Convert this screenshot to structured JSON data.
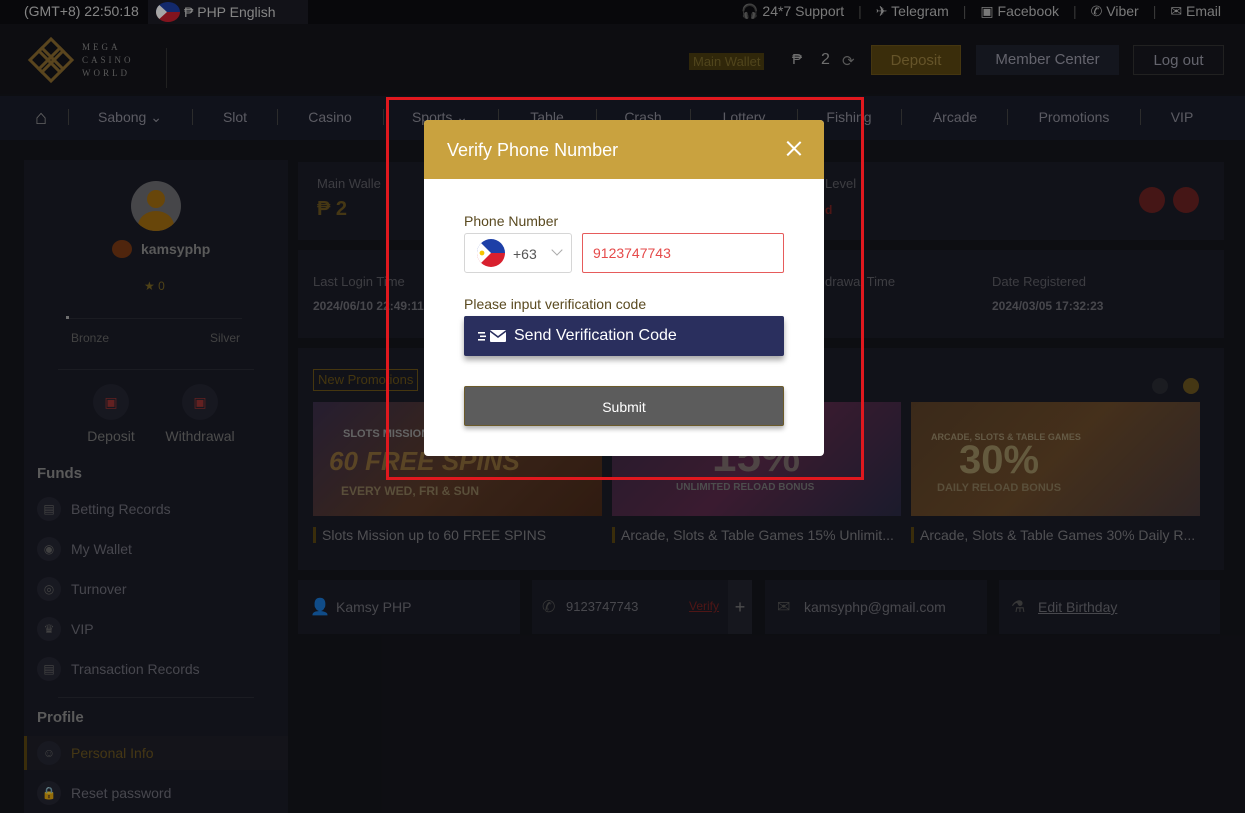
{
  "topbar": {
    "time": "(GMT+8) 22:50:18",
    "language": "₱ PHP English",
    "links": [
      "24*7 Support",
      "Telegram",
      "Facebook",
      "Viber",
      "Email"
    ]
  },
  "header": {
    "logo_lines": [
      "MEGA",
      "CASINO",
      "WORLD"
    ],
    "main_wallet_label": "Main Wallet",
    "currency_symbol": "₱",
    "balance": "2",
    "deposit_label": "Deposit",
    "member_center_label": "Member Center",
    "logout_label": "Log out"
  },
  "nav": {
    "items": [
      "Sabong",
      "Slot",
      "Casino",
      "Sports",
      "Table",
      "Crash",
      "Lottery",
      "Fishing",
      "Arcade",
      "Promotions",
      "VIP"
    ]
  },
  "sidebar": {
    "username": "kamsyphp",
    "stars": "★ 0",
    "level_from": "Bronze",
    "level_to": "Silver",
    "quick_buttons": [
      "Deposit",
      "Withdrawal"
    ],
    "funds_title": "Funds",
    "funds_items": [
      "Betting Records",
      "My Wallet",
      "Turnover",
      "VIP",
      "Transaction Records"
    ],
    "profile_title": "Profile",
    "profile_items": [
      "Personal Info",
      "Reset password"
    ]
  },
  "summary": {
    "main_wallet_label": "Main Walle",
    "main_wallet_value": "₱ 2",
    "level_label": "Level",
    "level_value": "d"
  },
  "login_info": {
    "last_login_label": "Last Login Time",
    "last_login_value": "2024/06/10 22:49:11",
    "withdraw_label": "drawal Time",
    "registered_label": "Date Registered",
    "registered_value": "2024/03/05 17:32:23"
  },
  "promotions": {
    "tag": "New Promotions",
    "cards": [
      {
        "banner_top": "SLOTS MISSION",
        "banner_big": "60 FREE SPINS",
        "banner_sub": "EVERY WED, FRI & SUN",
        "caption": "Slots Mission up to 60 FREE SPINS"
      },
      {
        "banner_big": "15%",
        "banner_sub": "UNLIMITED RELOAD BONUS",
        "caption": "Arcade, Slots & Table Games 15% Unlimit..."
      },
      {
        "banner_top": "ARCADE, SLOTS & TABLE GAMES",
        "banner_big": "30%",
        "banner_sub": "DAILY RELOAD BONUS",
        "caption": "Arcade, Slots & Table Games 30% Daily R..."
      }
    ]
  },
  "contact": {
    "name": "Kamsy PHP",
    "phone": "9123747743",
    "verify_label": "Verify",
    "email": "kamsyphp@gmail.com",
    "birthday_label": "Edit Birthday"
  },
  "modal": {
    "title": "Verify Phone Number",
    "phone_label": "Phone Number",
    "country_code": "+63",
    "phone_value": "9123747743",
    "verify_label": "Please input verification code",
    "send_label": "Send Verification Code",
    "submit_label": "Submit"
  },
  "colors": {
    "accent_gold": "#c9a23f",
    "send_button": "#2a2f5e",
    "highlight_red": "#e0181e"
  }
}
